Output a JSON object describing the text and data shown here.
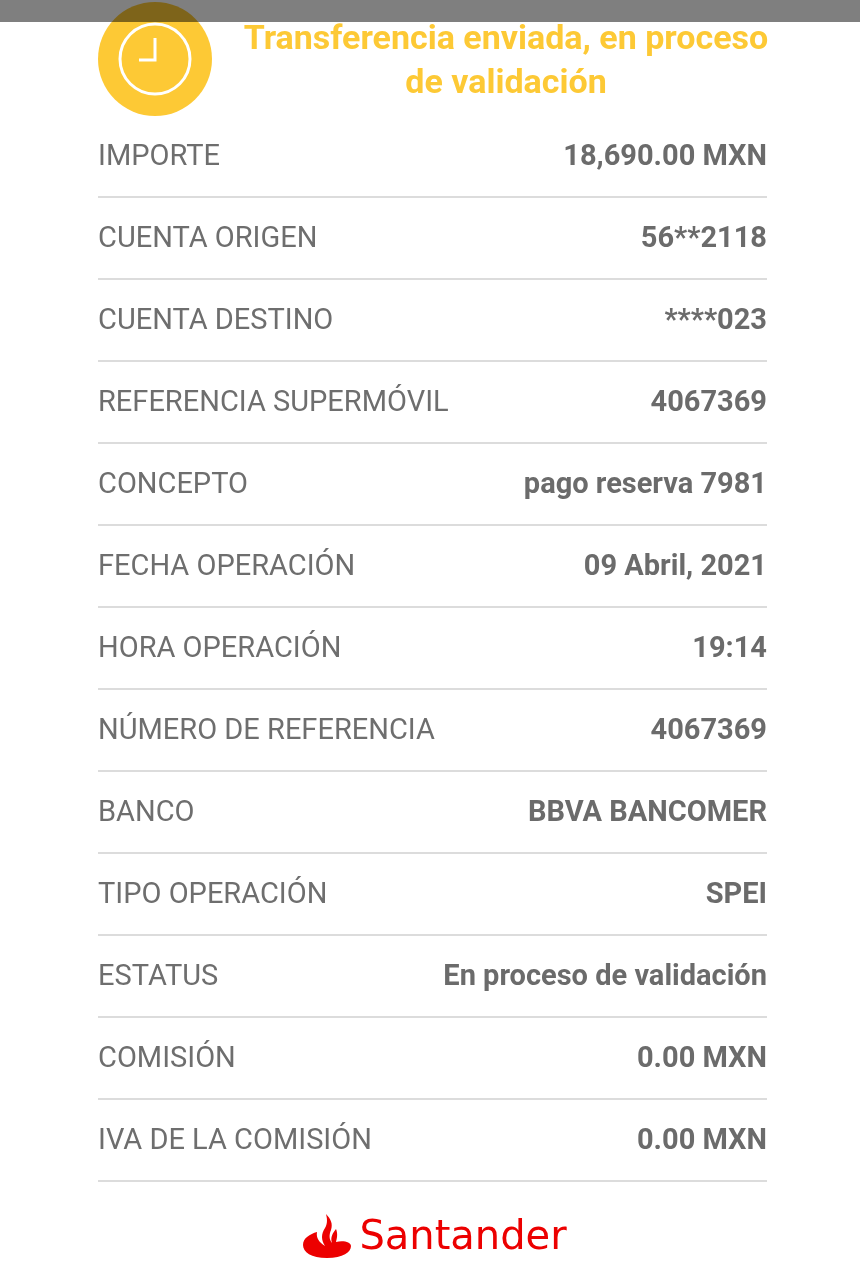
{
  "header": {
    "title": "Transferencia enviada, en proceso de validación"
  },
  "details": [
    {
      "label": "IMPORTE",
      "value": "18,690.00 MXN"
    },
    {
      "label": "CUENTA ORIGEN",
      "value": "56**2118"
    },
    {
      "label": "CUENTA DESTINO",
      "value": "****023"
    },
    {
      "label": "REFERENCIA SUPERMÓVIL",
      "value": "4067369"
    },
    {
      "label": "CONCEPTO",
      "value": "pago reserva 7981"
    },
    {
      "label": "FECHA OPERACIÓN",
      "value": "09 Abril, 2021"
    },
    {
      "label": "HORA OPERACIÓN",
      "value": "19:14"
    },
    {
      "label": "NÚMERO DE REFERENCIA",
      "value": "4067369"
    },
    {
      "label": "BANCO",
      "value": "BBVA BANCOMER"
    },
    {
      "label": "TIPO OPERACIÓN",
      "value": "SPEI"
    },
    {
      "label": "ESTATUS",
      "value": "En proceso de validación"
    },
    {
      "label": "COMISIÓN",
      "value": "0.00 MXN"
    },
    {
      "label": "IVA DE LA COMISIÓN",
      "value": "0.00 MXN"
    }
  ],
  "footer": {
    "brand": "Santander"
  }
}
